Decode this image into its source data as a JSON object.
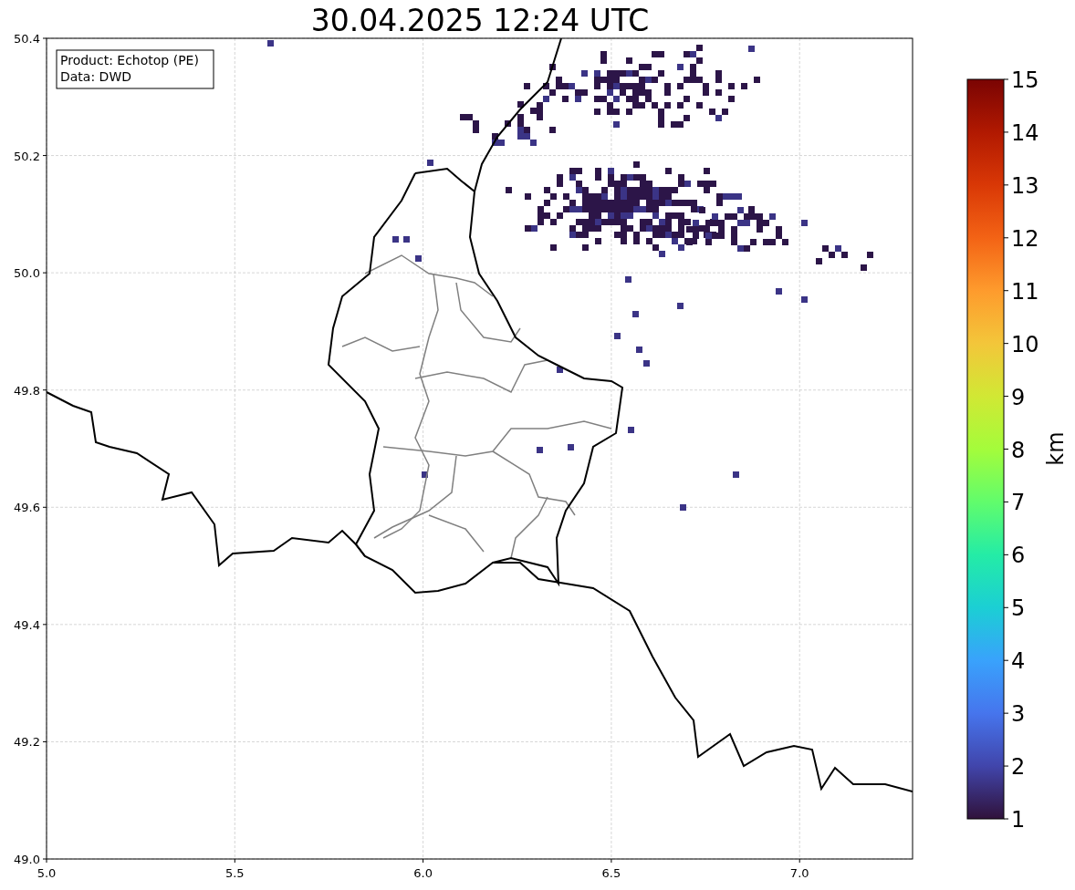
{
  "title": "30.04.2025 12:24 UTC",
  "info_box": {
    "lines": [
      "Product: Echotop (PE)",
      "Data: DWD"
    ]
  },
  "x_ticks": [
    "5.0",
    "5.5",
    "6.0",
    "6.5",
    "7.0"
  ],
  "y_ticks": [
    "50.4",
    "50.2",
    "50.0",
    "49.8",
    "49.6",
    "49.4",
    "49.2",
    "49.0"
  ],
  "colorbar": {
    "ticks": [
      "15",
      "14",
      "13",
      "12",
      "11",
      "10",
      "9",
      "8",
      "7",
      "6",
      "5",
      "4",
      "3",
      "2",
      "1"
    ],
    "label": "km"
  }
}
